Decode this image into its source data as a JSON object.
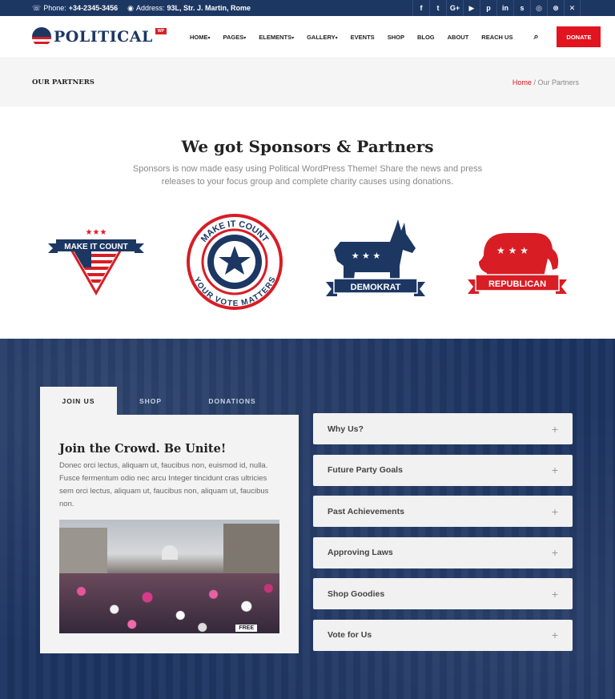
{
  "topbar": {
    "phone_label": "Phone:",
    "phone": "+34-2345-3456",
    "address_label": "Address:",
    "address": "93L, Str. J. Martin, Rome",
    "social": [
      "f",
      "t",
      "G+",
      "yt",
      "p",
      "in",
      "s",
      "ig",
      "d",
      "x"
    ]
  },
  "header": {
    "logo_text": "POLITICAL",
    "logo_badge": "WP",
    "nav": [
      "HOME",
      "PAGES",
      "ELEMENTS",
      "GALLERY",
      "EVENTS",
      "SHOP",
      "BLOG",
      "ABOUT",
      "REACH US"
    ],
    "nav_dropdown": [
      true,
      true,
      true,
      true,
      false,
      false,
      false,
      false,
      false
    ],
    "donate": "DONATE"
  },
  "titlebar": {
    "title": "OUR PARTNERS",
    "breadcrumb_home": "Home",
    "breadcrumb_sep": "/",
    "breadcrumb_current": "Our Partners"
  },
  "sponsors": {
    "heading": "We got Sponsors & Partners",
    "text": "Sponsors is now made easy using Political WordPress Theme! Share the news and press releases to your focus group and complete charity causes using donations.",
    "logos": {
      "make_it_count": "MAKE IT COUNT",
      "badge_top": "MAKE IT COUNT",
      "badge_bottom": "YOUR VOTE MATTERS",
      "demokrat": "DEMOKRAT",
      "republican": "REPUBLICAN"
    }
  },
  "tabs": [
    "JOIN US",
    "SHOP",
    "DONATIONS"
  ],
  "panel": {
    "heading": "Join the Crowd. Be Unite!",
    "text": "Donec orci lectus, aliquam ut, faucibus non, euismod id, nulla. Fusce fermentum odio nec arcu Integer tincidunt cras ultricies sem orci lectus, aliquam ut, faucibus non, aliquam ut, faucibus non.",
    "photo_sign": "FREE"
  },
  "accordion": [
    "Why Us?",
    "Future Party Goals",
    "Past Achievements",
    "Approving Laws",
    "Shop Goodies",
    "Vote for Us"
  ],
  "colors": {
    "navy": "#1d3763",
    "red": "#e1141f"
  }
}
